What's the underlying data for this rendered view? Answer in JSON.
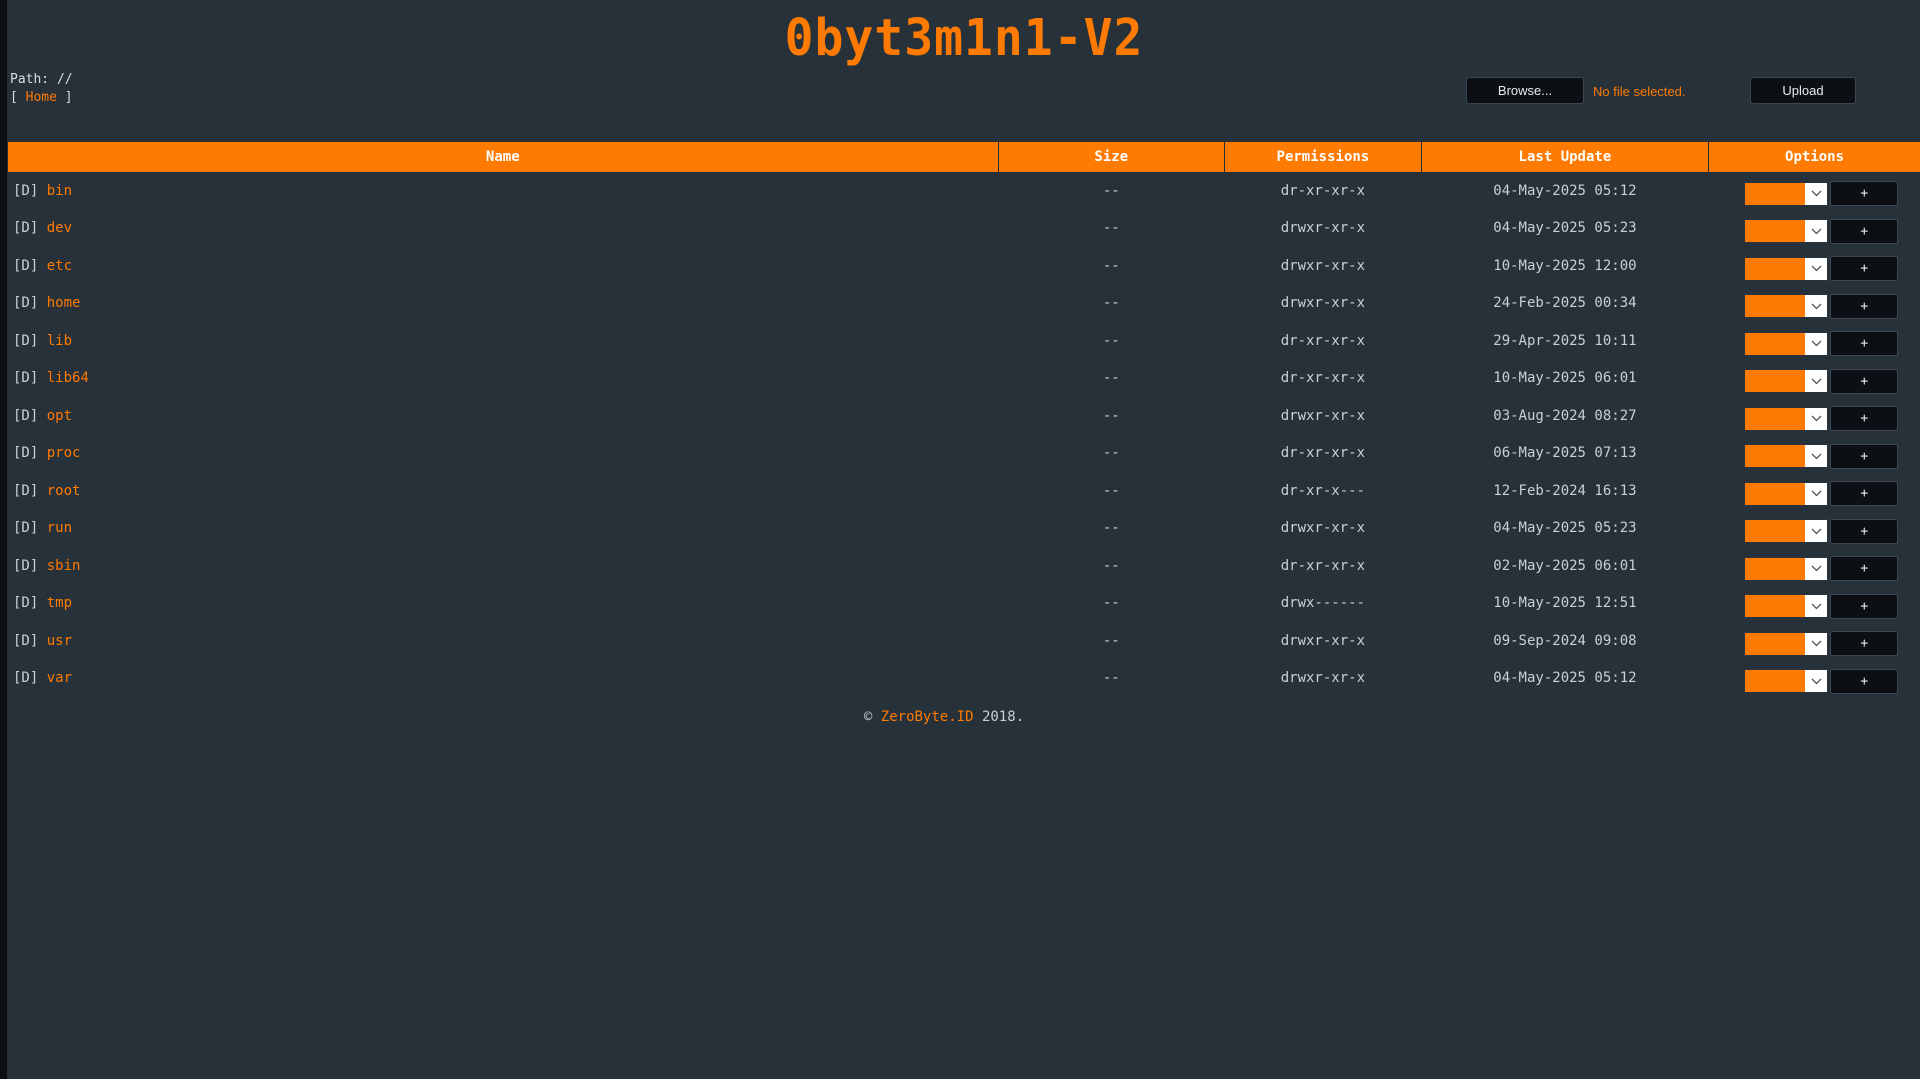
{
  "app": {
    "title": "0byt3m1n1-V2"
  },
  "path": {
    "label": "Path: //",
    "bracket_open": "[",
    "home_link": "Home",
    "bracket_close": "]"
  },
  "upload": {
    "browse_label": "Browse...",
    "file_status": "No file selected.",
    "upload_label": "Upload"
  },
  "table": {
    "headers": [
      "Name",
      "Size",
      "Permissions",
      "Last Update",
      "Options"
    ],
    "rows": [
      {
        "tag": "[D]",
        "name": "bin",
        "size": "--",
        "perms": "dr-xr-xr-x",
        "perm_style": "normal",
        "date": "04-May-2025 05:12",
        "action": "+"
      },
      {
        "tag": "[D]",
        "name": "dev",
        "size": "--",
        "perms": "drwxr-xr-x",
        "perm_style": "normal",
        "date": "04-May-2025 05:23",
        "action": "+"
      },
      {
        "tag": "[D]",
        "name": "etc",
        "size": "--",
        "perms": "drwxr-xr-x",
        "perm_style": "normal",
        "date": "10-May-2025 12:00",
        "action": "+"
      },
      {
        "tag": "[D]",
        "name": "home",
        "size": "--",
        "perms": "drwxr-xr-x",
        "perm_style": "normal",
        "date": "24-Feb-2025 00:34",
        "action": "+"
      },
      {
        "tag": "[D]",
        "name": "lib",
        "size": "--",
        "perms": "dr-xr-xr-x",
        "perm_style": "normal",
        "date": "29-Apr-2025 10:11",
        "action": "+"
      },
      {
        "tag": "[D]",
        "name": "lib64",
        "size": "--",
        "perms": "dr-xr-xr-x",
        "perm_style": "normal",
        "date": "10-May-2025 06:01",
        "action": "+"
      },
      {
        "tag": "[D]",
        "name": "opt",
        "size": "--",
        "perms": "drwxr-xr-x",
        "perm_style": "normal",
        "date": "03-Aug-2024 08:27",
        "action": "+"
      },
      {
        "tag": "[D]",
        "name": "proc",
        "size": "--",
        "perms": "dr-xr-xr-x",
        "perm_style": "normal",
        "date": "06-May-2025 07:13",
        "action": "+"
      },
      {
        "tag": "[D]",
        "name": "root",
        "size": "--",
        "perms": "dr-xr-x---",
        "perm_style": "red",
        "date": "12-Feb-2024 16:13",
        "action": "+"
      },
      {
        "tag": "[D]",
        "name": "run",
        "size": "--",
        "perms": "drwxr-xr-x",
        "perm_style": "normal",
        "date": "04-May-2025 05:23",
        "action": "+"
      },
      {
        "tag": "[D]",
        "name": "sbin",
        "size": "--",
        "perms": "dr-xr-xr-x",
        "perm_style": "normal",
        "date": "02-May-2025 06:01",
        "action": "+"
      },
      {
        "tag": "[D]",
        "name": "tmp",
        "size": "--",
        "perms": "drwx------",
        "perm_style": "green",
        "date": "10-May-2025 12:51",
        "action": "+"
      },
      {
        "tag": "[D]",
        "name": "usr",
        "size": "--",
        "perms": "drwxr-xr-x",
        "perm_style": "normal",
        "date": "09-Sep-2024 09:08",
        "action": "+"
      },
      {
        "tag": "[D]",
        "name": "var",
        "size": "--",
        "perms": "drwxr-xr-x",
        "perm_style": "normal",
        "date": "04-May-2025 05:12",
        "action": "+"
      }
    ]
  },
  "footer": {
    "copyright": "©",
    "brand": "ZeroByte.ID",
    "year": "2018."
  },
  "icons": {
    "select_chevron": "chevron-down-icon"
  },
  "colors": {
    "accent": "#ff7a00",
    "background": "#26313a",
    "perm_red": "#d62020",
    "perm_green": "#19c419"
  }
}
